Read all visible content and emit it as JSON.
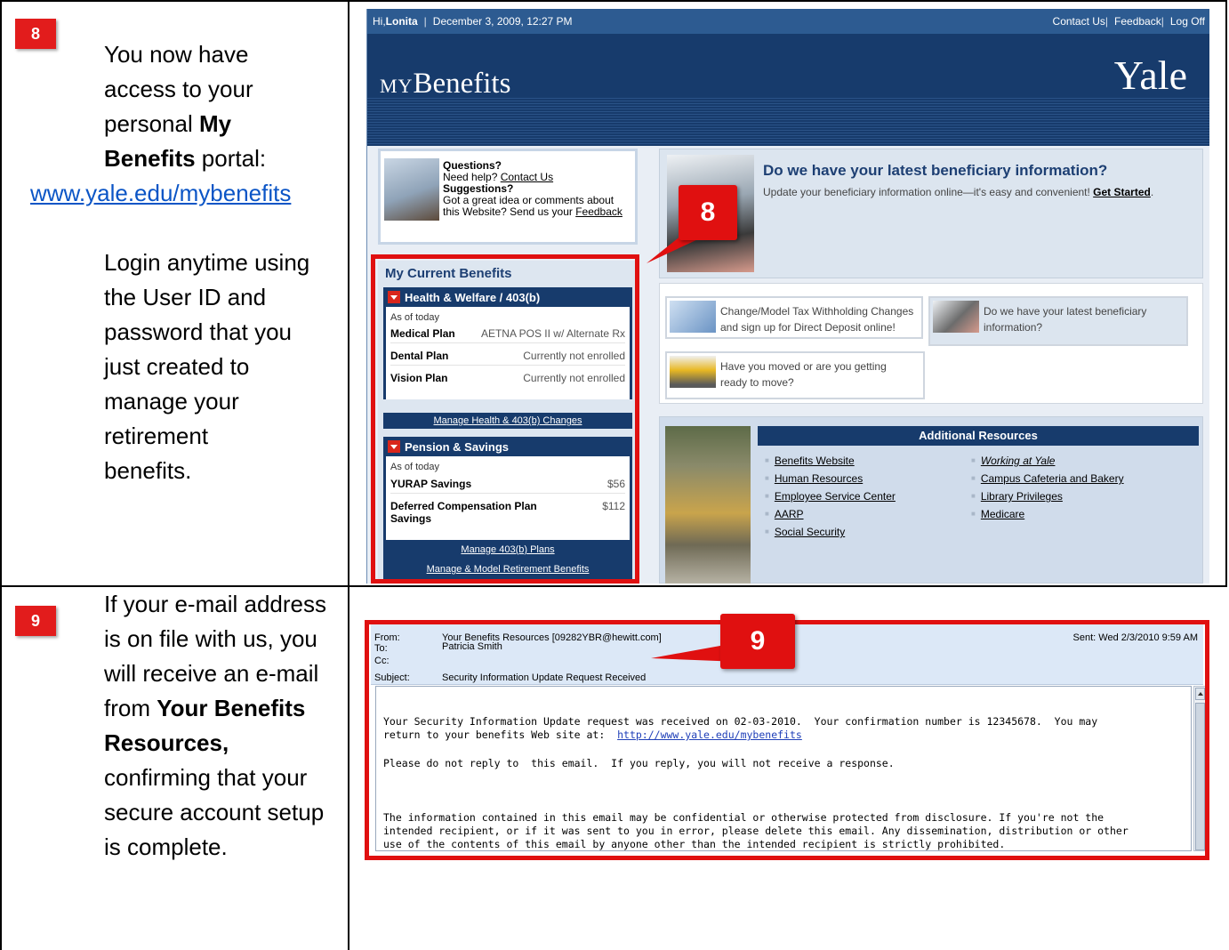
{
  "step8": {
    "badge": "8",
    "line1": "You now have",
    "line2": "access to your",
    "line3a": "personal ",
    "line3b": "My",
    "line4a": "Benefits",
    "line4b": " portal:",
    "link": "www.yale.edu/mybenefits",
    "para2": [
      "Login anytime using",
      "the User ID and",
      "password that you",
      "just created to",
      "manage your",
      "retirement",
      "benefits."
    ]
  },
  "step9": {
    "badge": "9",
    "lines": [
      "If your e-mail address",
      "is on file with us, you",
      "will receive an e-mail",
      "from "
    ],
    "bold1": "Your Benefits",
    "bold2": "Resources,",
    "lines2": [
      "confirming that your",
      "secure account setup",
      "is complete."
    ]
  },
  "portal": {
    "topbar": {
      "greeting": "Hi, ",
      "name": "Lonita",
      "datetime": "December 3, 2009, 12:27 PM",
      "contact": "Contact Us",
      "feedback": "Feedback",
      "logoff": "Log Off",
      "sep": "|"
    },
    "logo_small": "MY",
    "logo_main": "Benefits",
    "yale": "Yale",
    "help": {
      "q_title": "Questions?",
      "q_text": "Need help? ",
      "q_link": "Contact Us",
      "s_title": "Suggestions?",
      "s_text1": "Got a great idea or comments about",
      "s_text2": "this Website? Send us your ",
      "s_link": "Feedback"
    },
    "benefits": {
      "title": "My Current Benefits",
      "health_head": "Health & Welfare / 403(b)",
      "as_of": "As of today",
      "rows": [
        {
          "k": "Medical Plan",
          "v": "AETNA POS II w/ Alternate Rx"
        },
        {
          "k": "Dental Plan",
          "v": "Currently not enrolled"
        },
        {
          "k": "Vision Plan",
          "v": "Currently not enrolled"
        }
      ],
      "manage_health": "Manage Health & 403(b) Changes",
      "pension_head": "Pension & Savings",
      "as_of2": "As of today",
      "yurap_k": "YURAP Savings",
      "yurap_v": "$56",
      "defcomp_k1": "Deferred Compensation Plan",
      "defcomp_k2": "Savings",
      "defcomp_v": "$112",
      "manage_403": "Manage 403(b) Plans",
      "manage_ret": "Manage & Model Retirement Benefits"
    },
    "beneficiary": {
      "title": "Do we have your latest beneficiary information?",
      "desc": "Update your beneficiary information online—it's easy and convenient! ",
      "link": "Get Started",
      "period": "."
    },
    "tiles": [
      {
        "line1": "Change/Model Tax Withholding Changes",
        "line2": "and sign up for Direct Deposit online!"
      },
      {
        "line1": "Do we have your latest beneficiary",
        "line2": "information?"
      },
      {
        "line1": "Have you moved or are you getting",
        "line2": "ready to move?"
      }
    ],
    "additional": {
      "head": "Additional Resources",
      "col1": [
        "Benefits Website",
        "Human Resources",
        "Employee Service Center",
        "AARP",
        "Social Security"
      ],
      "col2": [
        "Working at Yale",
        "Campus Cafeteria and Bakery",
        "Library Privileges",
        "Medicare"
      ]
    },
    "callout": "8"
  },
  "email": {
    "from_lbl": "From:",
    "from_val": "Your Benefits Resources [09282YBR@hewitt.com]",
    "to_lbl": "To:",
    "to_val": "Patricia Smith",
    "cc_lbl": "Cc:",
    "subject_lbl": "Subject:",
    "subject_val": "Security Information Update Request Received",
    "sent": "Sent:   Wed 2/3/2010 9:59 AM",
    "body1a": "Your Security Information Update request was received on 02-03-2010.  Your confirmation number is 12345678.  You may",
    "body1b": "return to your benefits Web site at:  ",
    "body1_link": "http://www.yale.edu/mybenefits",
    "body2": "Please do not reply to  this email.  If you reply, you will not receive a response.",
    "body3a": "The information contained in this email may be confidential or otherwise protected from disclosure. If you're not the",
    "body3b": "intended recipient, or if it was sent to you in error, please delete this email. Any dissemination, distribution or other",
    "body3c": "use of the contents of this email by anyone other than the intended recipient is strictly prohibited.",
    "callout": "9"
  },
  "colors": {
    "highlight": "#e01010",
    "navy": "#173b6c",
    "link": "#0b55c6"
  }
}
